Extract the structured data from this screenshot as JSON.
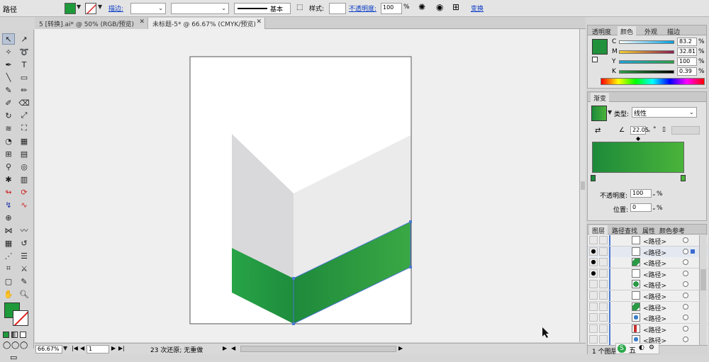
{
  "control_bar": {
    "selection_label": "路径",
    "stroke_link": "描边:",
    "stroke_weight": "",
    "stroke_profile_label": "基本",
    "style_label": "样式:",
    "opacity_link": "不透明度:",
    "opacity_value": "100",
    "opacity_unit": "%",
    "transform_link": "变换",
    "fill_color": "#1e9a3a"
  },
  "doc_tabs": [
    {
      "label": "5 [转换].ai* @ 50% (RGB/预览)"
    },
    {
      "label": "未标题-5* @ 66.67% (CMYK/预览)"
    }
  ],
  "color_panel": {
    "tabs": [
      "透明度",
      "颜色",
      "外观",
      "描边"
    ],
    "channels": [
      {
        "name": "C",
        "value": "83.2",
        "unit": "%"
      },
      {
        "name": "M",
        "value": "32.81",
        "unit": "%"
      },
      {
        "name": "Y",
        "value": "100",
        "unit": "%"
      },
      {
        "name": "K",
        "value": "0.39",
        "unit": "%"
      }
    ],
    "swatch": "#21913c"
  },
  "gradient_panel": {
    "tab": "渐变",
    "type_label": "类型:",
    "type_value": "线性",
    "angle_value": "22.05",
    "angle_unit": "°",
    "opacity_label": "不透明度:",
    "opacity_value": "100",
    "opacity_unit": "%",
    "location_label": "位置:",
    "location_value": "0",
    "location_unit": "%",
    "start_color": "#1d8a3a",
    "end_color": "#4ab43a"
  },
  "layers_panel": {
    "tabs": [
      "图层",
      "路径查找",
      "属性",
      "颜色参考"
    ],
    "rows": [
      {
        "label": "<路径>",
        "eye": false,
        "thumb": "line"
      },
      {
        "label": "<路径>",
        "eye": true,
        "thumb": "line"
      },
      {
        "label": "<路径>",
        "eye": true,
        "thumb": "green"
      },
      {
        "label": "<路径>",
        "eye": true,
        "thumb": "empty"
      },
      {
        "label": "<路径>",
        "eye": false,
        "thumb": "greenoval"
      },
      {
        "label": "<路径>",
        "eye": false,
        "thumb": "empty"
      },
      {
        "label": "<路径>",
        "eye": false,
        "thumb": "green"
      },
      {
        "label": "<路径>",
        "eye": false,
        "thumb": "blue"
      },
      {
        "label": "<路径>",
        "eye": false,
        "thumb": "red"
      },
      {
        "label": "<路径>",
        "eye": false,
        "thumb": "blue"
      }
    ],
    "footer_label": "1 个图层"
  },
  "status_bar": {
    "zoom": "66.67%",
    "page": "1",
    "message": "23 次还原; 无重做"
  },
  "ime": {
    "label": "五"
  },
  "artwork_colors": {
    "gray_light": "#ebebeb",
    "gray_dark": "#d9d9db",
    "green_left": "#28a447",
    "green_right": "#32a346"
  }
}
